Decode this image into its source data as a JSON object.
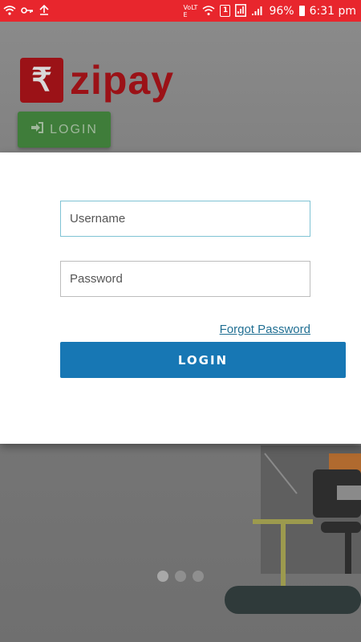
{
  "status_bar": {
    "volte": "VoLTE",
    "sim_badge": "1",
    "battery": "96%",
    "time": "6:31 pm"
  },
  "background": {
    "logo_text": "zipay",
    "logo_symbol": "₹",
    "login_button_label": "LOGIN"
  },
  "login_modal": {
    "username_placeholder": "Username",
    "password_placeholder": "Password",
    "forgot_password_label": "Forgot Password",
    "login_button_label": "LOGIN"
  },
  "colors": {
    "status_bar": "#e8262d",
    "brand": "#9b1217",
    "primary_button": "#1777b4",
    "bg_login_button": "#3f7d3a"
  },
  "carousel": {
    "total": 3,
    "active": 1
  }
}
